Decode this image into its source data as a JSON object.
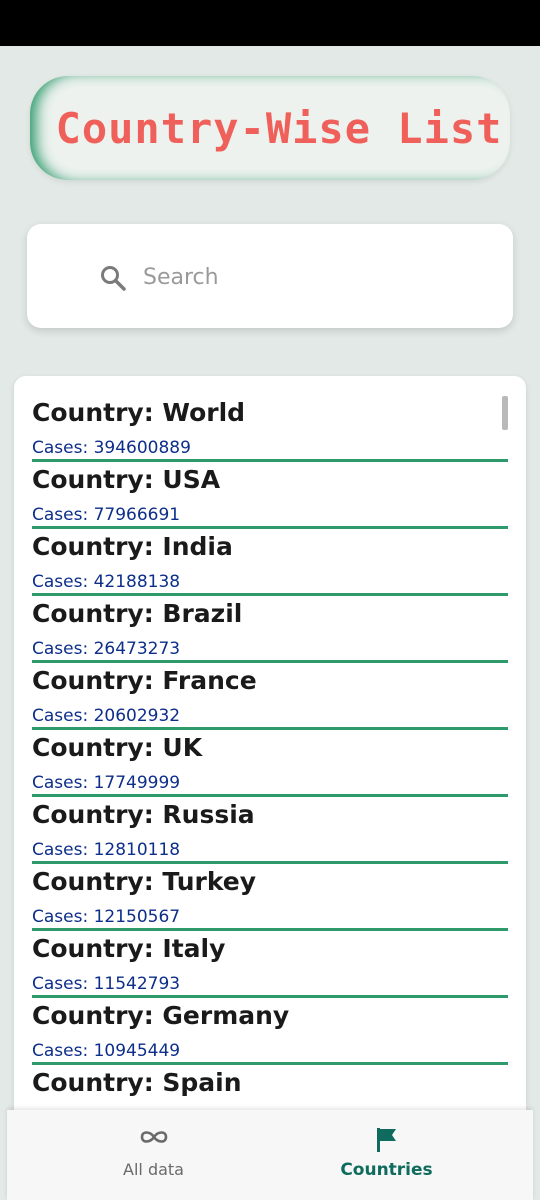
{
  "header": {
    "title": "Country-Wise List"
  },
  "search": {
    "placeholder": "Search",
    "value": ""
  },
  "list": {
    "items": [
      {
        "country": "Country: World",
        "cases": "Cases:  394600889"
      },
      {
        "country": "Country: USA",
        "cases": "Cases:  77966691"
      },
      {
        "country": "Country: India",
        "cases": "Cases:  42188138"
      },
      {
        "country": "Country: Brazil",
        "cases": "Cases:  26473273"
      },
      {
        "country": "Country: France",
        "cases": "Cases:  20602932"
      },
      {
        "country": "Country: UK",
        "cases": "Cases:  17749999"
      },
      {
        "country": "Country: Russia",
        "cases": "Cases:  12810118"
      },
      {
        "country": "Country: Turkey",
        "cases": "Cases:  12150567"
      },
      {
        "country": "Country: Italy",
        "cases": "Cases:  11542793"
      },
      {
        "country": "Country: Germany",
        "cases": "Cases:  10945449"
      },
      {
        "country": "Country: Spain",
        "cases": ""
      }
    ]
  },
  "bottom_nav": {
    "items": [
      {
        "label": "All data",
        "icon": "infinity-icon",
        "active": false
      },
      {
        "label": "Countries",
        "icon": "flag-icon",
        "active": true
      }
    ]
  },
  "colors": {
    "title": "#f0605a",
    "accent_green": "#2e9a6c",
    "cases_text": "#0d2e8a",
    "active_nav": "#0f6b5e",
    "caret": "#e0145c"
  }
}
